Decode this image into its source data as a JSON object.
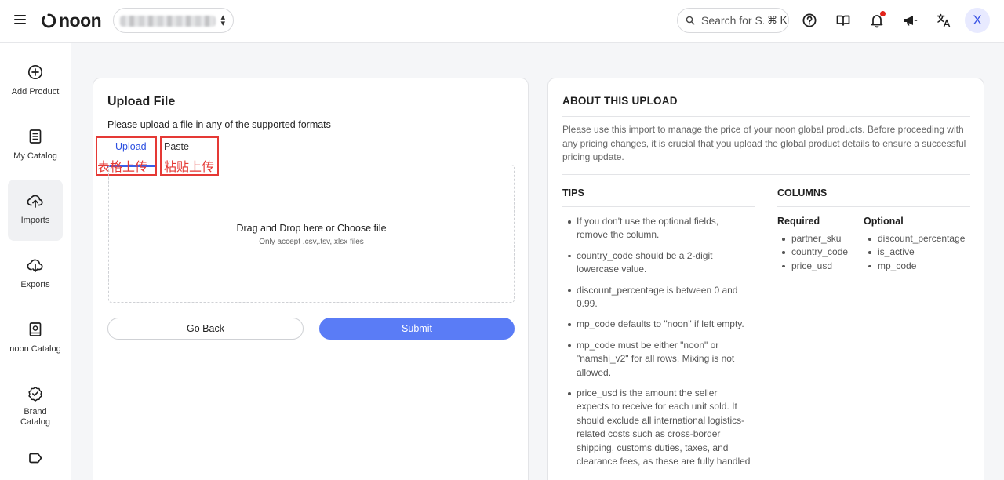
{
  "header": {
    "logo_text": "noon",
    "store_selector": {
      "value": ""
    },
    "search": {
      "placeholder": "Search for S...",
      "shortcut": "⌘ K"
    },
    "icons": [
      "help-icon",
      "book-icon",
      "bell-icon",
      "megaphone-icon",
      "translate-icon"
    ],
    "avatar_initial": "X",
    "notification_dot_color": "#e2231a"
  },
  "sidebar": {
    "items": [
      {
        "label": "Add Product",
        "icon": "plus-circle-icon"
      },
      {
        "label": "My Catalog",
        "icon": "catalog-icon"
      },
      {
        "label": "Imports",
        "icon": "cloud-upload-icon",
        "active": true
      },
      {
        "label": "Exports",
        "icon": "cloud-download-icon"
      },
      {
        "label": "noon Catalog",
        "icon": "noon-catalog-icon"
      },
      {
        "label": "Brand\nCatalog",
        "icon": "badge-check-icon"
      },
      {
        "label": "",
        "icon": "tag-icon"
      }
    ]
  },
  "upload": {
    "title": "Upload File",
    "subtitle": "Please upload a file in any of the supported formats",
    "tabs": [
      {
        "label": "Upload",
        "annotation": "表格上传",
        "active": true
      },
      {
        "label": "Paste",
        "annotation": "粘贴上传"
      }
    ],
    "dropzone": {
      "title": "Drag and Drop here or Choose file",
      "subtitle": "Only accept .csv,.tsv,.xlsx files"
    },
    "back_label": "Go Back",
    "submit_label": "Submit"
  },
  "about": {
    "title": "ABOUT THIS UPLOAD",
    "body": "Please use this import to manage the price of your noon global products. Before proceeding with any pricing changes, it is crucial that you upload the global product details to ensure a successful pricing update.",
    "tips_title": "TIPS",
    "tips": [
      "If you don't use the optional fields, remove the column.",
      "country_code should be a 2-digit lowercase value.",
      "discount_percentage is between 0 and 0.99.",
      "mp_code defaults to \"noon\" if left empty.",
      "mp_code must be either \"noon\" or \"namshi_v2\" for all rows. Mixing is not allowed.",
      "price_usd is the amount the seller expects to receive for each unit sold. It should exclude all international logistics-related costs such as cross-border shipping, customs duties, taxes, and clearance fees, as these are fully handled"
    ],
    "columns_title": "COLUMNS",
    "required_title": "Required",
    "required": [
      "partner_sku",
      "country_code",
      "price_usd"
    ],
    "optional_title": "Optional",
    "optional": [
      "discount_percentage",
      "is_active",
      "mp_code"
    ]
  },
  "colors": {
    "accent": "#3b5ee8",
    "submit": "#5a7cf6",
    "annotation": "#e53935"
  }
}
